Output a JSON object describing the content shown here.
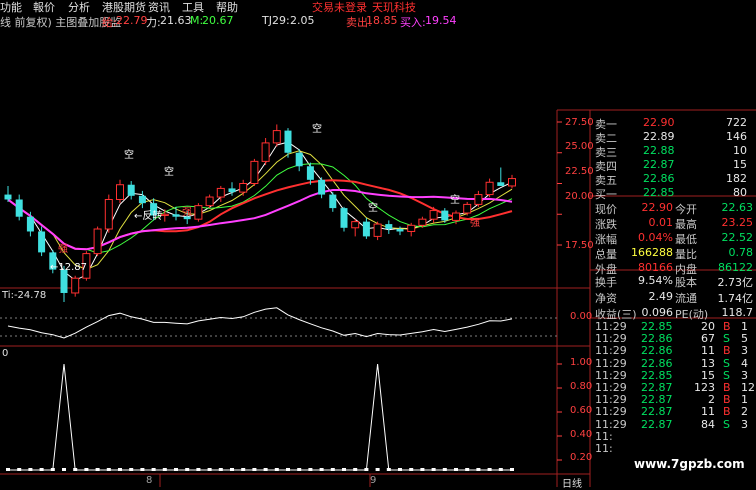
{
  "menu": {
    "items": [
      "功能",
      "報价",
      "分析",
      "港股期货",
      "资讯",
      "工具",
      "帮助"
    ],
    "status_login": "交易未登录",
    "brand": "天玑科技"
  },
  "infobar": {
    "title": "线 前复权) 主图叠加股监",
    "gei_label": "给:",
    "gei_value": "22.79",
    "li_label": "力:",
    "li_value": "21.63",
    "m_label": "M:",
    "m_value": "20.67",
    "tj_label": "TJ29:",
    "tj_value": "2.05",
    "sell_label": "卖出:",
    "sell_value": "18.85",
    "buy_label": "买入:",
    "buy_value": "19.54"
  },
  "chart": {
    "price_ticks": [
      "27.50",
      "25.00",
      "22.50",
      "20.00",
      "17.50"
    ],
    "osc_label": "Ti:-24.78",
    "osc_tick": "0.00",
    "sig_label": "0",
    "sig_ticks": [
      "1.00",
      "0.80",
      "0.60",
      "0.40",
      "0.20"
    ],
    "annotations": {
      "kong1": "空",
      "kong2": "空",
      "kong3": "空",
      "kong4": "空",
      "kong5": "空",
      "fanzhuan": "反转",
      "qiang1": "强",
      "qiang2": "强",
      "qiang3": "强",
      "low": "12.87"
    },
    "x_labels": [
      "8",
      "9"
    ],
    "period": "日线",
    "candles": [
      {
        "o": 21.6,
        "h": 22.3,
        "l": 21.0,
        "c": 21.2
      },
      {
        "o": 21.2,
        "h": 21.6,
        "l": 19.5,
        "c": 19.8
      },
      {
        "o": 19.8,
        "h": 20.2,
        "l": 18.2,
        "c": 18.6
      },
      {
        "o": 18.6,
        "h": 19.0,
        "l": 16.6,
        "c": 16.9
      },
      {
        "o": 16.9,
        "h": 17.1,
        "l": 15.2,
        "c": 15.5
      },
      {
        "o": 15.5,
        "h": 15.8,
        "l": 12.87,
        "c": 13.6
      },
      {
        "o": 13.6,
        "h": 15.0,
        "l": 13.3,
        "c": 14.8
      },
      {
        "o": 14.8,
        "h": 17.0,
        "l": 14.6,
        "c": 16.8
      },
      {
        "o": 16.8,
        "h": 19.0,
        "l": 16.6,
        "c": 18.8
      },
      {
        "o": 18.8,
        "h": 21.6,
        "l": 18.5,
        "c": 21.2
      },
      {
        "o": 21.2,
        "h": 22.8,
        "l": 20.9,
        "c": 22.4
      },
      {
        "o": 22.4,
        "h": 22.7,
        "l": 21.2,
        "c": 21.5
      },
      {
        "o": 21.5,
        "h": 21.9,
        "l": 20.5,
        "c": 20.9
      },
      {
        "o": 20.9,
        "h": 21.3,
        "l": 19.5,
        "c": 19.9
      },
      {
        "o": 19.9,
        "h": 20.4,
        "l": 19.4,
        "c": 20.0
      },
      {
        "o": 20.0,
        "h": 20.6,
        "l": 19.5,
        "c": 19.8
      },
      {
        "o": 19.8,
        "h": 20.3,
        "l": 19.2,
        "c": 19.6
      },
      {
        "o": 19.6,
        "h": 20.9,
        "l": 19.4,
        "c": 20.7
      },
      {
        "o": 20.7,
        "h": 21.6,
        "l": 20.5,
        "c": 21.4
      },
      {
        "o": 21.4,
        "h": 22.3,
        "l": 21.0,
        "c": 22.1
      },
      {
        "o": 22.1,
        "h": 22.6,
        "l": 21.5,
        "c": 21.8
      },
      {
        "o": 21.8,
        "h": 22.8,
        "l": 21.5,
        "c": 22.5
      },
      {
        "o": 22.5,
        "h": 24.5,
        "l": 22.3,
        "c": 24.3
      },
      {
        "o": 24.3,
        "h": 26.2,
        "l": 24.0,
        "c": 25.8
      },
      {
        "o": 25.8,
        "h": 27.3,
        "l": 25.5,
        "c": 26.8
      },
      {
        "o": 26.8,
        "h": 27.0,
        "l": 24.6,
        "c": 25.0
      },
      {
        "o": 25.0,
        "h": 25.3,
        "l": 23.5,
        "c": 23.9
      },
      {
        "o": 23.9,
        "h": 24.2,
        "l": 22.4,
        "c": 22.8
      },
      {
        "o": 22.8,
        "h": 23.0,
        "l": 21.3,
        "c": 21.6
      },
      {
        "o": 21.6,
        "h": 21.8,
        "l": 20.2,
        "c": 20.5
      },
      {
        "o": 20.5,
        "h": 20.6,
        "l": 18.6,
        "c": 18.9
      },
      {
        "o": 18.9,
        "h": 19.6,
        "l": 18.2,
        "c": 19.4
      },
      {
        "o": 19.4,
        "h": 19.7,
        "l": 18.0,
        "c": 18.2
      },
      {
        "o": 18.2,
        "h": 19.4,
        "l": 17.9,
        "c": 19.2
      },
      {
        "o": 19.2,
        "h": 19.5,
        "l": 18.4,
        "c": 18.8
      },
      {
        "o": 18.8,
        "h": 19.0,
        "l": 18.3,
        "c": 18.6
      },
      {
        "o": 18.6,
        "h": 19.3,
        "l": 18.2,
        "c": 19.1
      },
      {
        "o": 19.1,
        "h": 19.8,
        "l": 18.9,
        "c": 19.6
      },
      {
        "o": 19.6,
        "h": 20.6,
        "l": 19.3,
        "c": 20.3
      },
      {
        "o": 20.3,
        "h": 20.5,
        "l": 19.3,
        "c": 19.5
      },
      {
        "o": 19.5,
        "h": 20.3,
        "l": 19.2,
        "c": 20.1
      },
      {
        "o": 20.1,
        "h": 21.0,
        "l": 19.9,
        "c": 20.8
      },
      {
        "o": 20.8,
        "h": 21.9,
        "l": 20.6,
        "c": 21.6
      },
      {
        "o": 21.6,
        "h": 22.9,
        "l": 21.4,
        "c": 22.6
      },
      {
        "o": 22.6,
        "h": 23.8,
        "l": 22.3,
        "c": 22.3
      },
      {
        "o": 22.3,
        "h": 23.2,
        "l": 22.1,
        "c": 22.9
      }
    ]
  },
  "quote": {
    "book": [
      {
        "label": "卖一",
        "price": "22.90",
        "vol": "722",
        "pc": "red"
      },
      {
        "label": "卖二",
        "price": "22.89",
        "vol": "146",
        "pc": "white"
      },
      {
        "label": "卖三",
        "price": "22.88",
        "vol": "10",
        "pc": "green"
      },
      {
        "label": "卖四",
        "price": "22.87",
        "vol": "15",
        "pc": "green"
      },
      {
        "label": "卖五",
        "price": "22.86",
        "vol": "182",
        "pc": "green"
      },
      {
        "label": "买一",
        "price": "22.85",
        "vol": "80",
        "pc": "green"
      }
    ],
    "stats": [
      {
        "l1": "现价",
        "v1": "22.90",
        "c1": "red",
        "l2": "今开",
        "v2": "22.63",
        "c2": "green"
      },
      {
        "l1": "涨跌",
        "v1": "0.01",
        "c1": "red",
        "l2": "最高",
        "v2": "23.25",
        "c2": "red"
      },
      {
        "l1": "涨幅",
        "v1": "0.04%",
        "c1": "red",
        "l2": "最低",
        "v2": "22.52",
        "c2": "green"
      },
      {
        "l1": "总量",
        "v1": "166288",
        "c1": "yellow",
        "l2": "量比",
        "v2": "0.78",
        "c2": "green"
      },
      {
        "l1": "外盘",
        "v1": "80166",
        "c1": "red",
        "l2": "内盘",
        "v2": "86122",
        "c2": "green"
      }
    ],
    "extra": [
      {
        "l1": "换手",
        "v1": "9.54%",
        "l2": "股本",
        "v2": "2.73亿"
      },
      {
        "l1": "净资",
        "v1": "2.49",
        "l2": "流通",
        "v2": "1.74亿"
      },
      {
        "l1": "收益(三)",
        "v1": "0.096",
        "l2": "PE(动)",
        "v2": "118.7"
      }
    ],
    "ticks": [
      {
        "t": "11:29",
        "p": "22.85",
        "pc": "green",
        "v": "20",
        "s": "B",
        "sc": "red",
        "n": "1"
      },
      {
        "t": "11:29",
        "p": "22.86",
        "pc": "green",
        "v": "67",
        "s": "S",
        "sc": "green",
        "n": "5"
      },
      {
        "t": "11:29",
        "p": "22.86",
        "pc": "green",
        "v": "11",
        "s": "B",
        "sc": "red",
        "n": "3"
      },
      {
        "t": "11:29",
        "p": "22.86",
        "pc": "green",
        "v": "13",
        "s": "S",
        "sc": "green",
        "n": "4"
      },
      {
        "t": "11:29",
        "p": "22.85",
        "pc": "green",
        "v": "15",
        "s": "S",
        "sc": "green",
        "n": "3"
      },
      {
        "t": "11:29",
        "p": "22.87",
        "pc": "green",
        "v": "123",
        "s": "B",
        "sc": "red",
        "n": "12"
      },
      {
        "t": "11:29",
        "p": "22.87",
        "pc": "green",
        "v": "2",
        "s": "B",
        "sc": "red",
        "n": "1"
      },
      {
        "t": "11:29",
        "p": "22.87",
        "pc": "green",
        "v": "11",
        "s": "B",
        "sc": "red",
        "n": "2"
      },
      {
        "t": "11:29",
        "p": "22.87",
        "pc": "green",
        "v": "84",
        "s": "S",
        "sc": "green",
        "n": "3"
      },
      {
        "t": "11:",
        "p": "",
        "pc": "green",
        "v": "",
        "s": "",
        "sc": "red",
        "n": ""
      },
      {
        "t": "11:",
        "p": "",
        "pc": "green",
        "v": "",
        "s": "",
        "sc": "red",
        "n": ""
      }
    ],
    "watermark": "www.7gpzb.com"
  }
}
